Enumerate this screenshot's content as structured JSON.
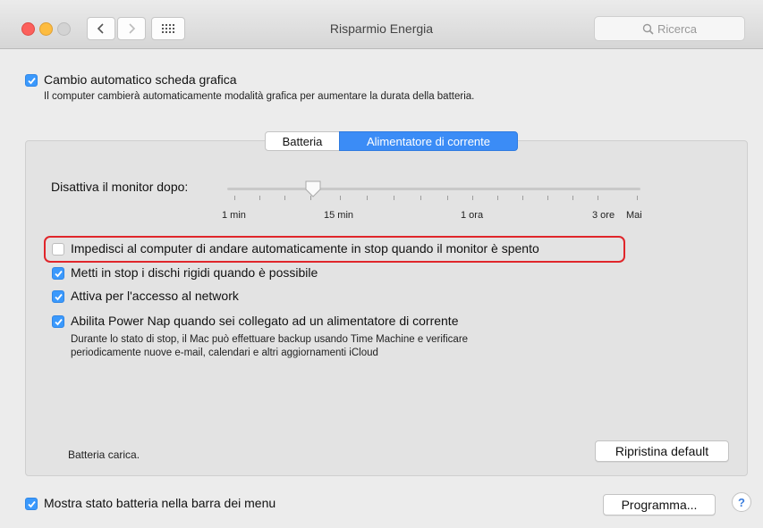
{
  "window": {
    "title": "Risparmio Energia",
    "search_placeholder": "Ricerca"
  },
  "graphics_switch": {
    "label": "Cambio automatico scheda grafica",
    "checked": true,
    "description": "Il computer cambierà automaticamente modalità grafica per aumentare la durata della batteria."
  },
  "tabs": [
    {
      "label": "Batteria",
      "selected": false
    },
    {
      "label": "Alimentatore di corrente",
      "selected": true
    }
  ],
  "display_sleep": {
    "label": "Disattiva il monitor dopo:",
    "tick_labels": [
      "1 min",
      "15 min",
      "1 ora",
      "3 ore",
      "Mai"
    ],
    "value": "15 min"
  },
  "options": [
    {
      "label": "Impedisci al computer di andare automaticamente in stop quando il monitor è spento",
      "checked": false
    },
    {
      "label": "Metti in stop i dischi rigidi quando è possibile",
      "checked": true
    },
    {
      "label": "Attiva per l'accesso al network",
      "checked": true
    },
    {
      "label": "Abilita Power Nap quando sei collegato ad un alimentatore di corrente",
      "checked": true
    }
  ],
  "power_nap_description": [
    "Durante lo stato di stop, il Mac può effettuare backup usando Time Machine e verificare",
    "periodicamente nuove e-mail, calendari e altri aggiornamenti iCloud"
  ],
  "battery_status": "Batteria carica.",
  "restore_button": "Ripristina default",
  "menu_bar_battery": {
    "label": "Mostra stato batteria nella barra dei menu",
    "checked": true
  },
  "schedule_button": "Programma...",
  "help_button": "?",
  "colors": {
    "accent": "#3b99fc",
    "highlight": "#e0262b"
  }
}
